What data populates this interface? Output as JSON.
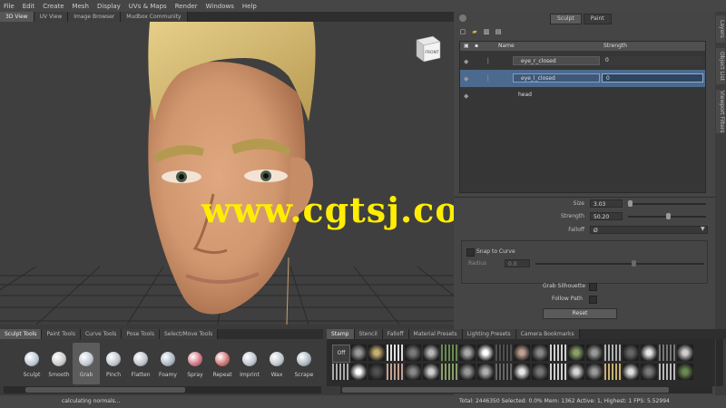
{
  "menubar": [
    "File",
    "Edit",
    "Create",
    "Mesh",
    "Display",
    "UVs & Maps",
    "Render",
    "Windows",
    "Help"
  ],
  "viewport_tabs": [
    {
      "label": "3D View",
      "active": true
    },
    {
      "label": "UV View",
      "active": false
    },
    {
      "label": "Image Browser",
      "active": false
    },
    {
      "label": "Mudbox Community",
      "active": false
    }
  ],
  "viewcube_label": "FRONT",
  "watermark": "www.cgtsj.com",
  "panel_tabs": [
    {
      "label": "Sculpt",
      "active": true
    },
    {
      "label": "Paint",
      "active": false
    }
  ],
  "side_tabs": [
    "Layers",
    "Object List",
    "Viewport Filters"
  ],
  "layers": {
    "headers": {
      "name": "Name",
      "strength": "Strength"
    },
    "rows": [
      {
        "name": "eye_r_closed",
        "strength": "0",
        "selected": false
      },
      {
        "name": "eye_l_closed",
        "strength": "0",
        "selected": true
      },
      {
        "name": "head",
        "strength": "",
        "selected": false
      }
    ]
  },
  "props": {
    "size_label": "Size",
    "size_value": "3.03",
    "strength_label": "Strength",
    "strength_value": "50.20",
    "falloff_label": "Falloff",
    "falloff_value": "Ø",
    "snap_label": "Snap to Curve",
    "radius_label": "Radius",
    "radius_value": "0.0",
    "grab_silhouette_label": "Grab Silhouette",
    "follow_path_label": "Follow Path",
    "reset_label": "Reset"
  },
  "bottom_tabs": [
    {
      "label": "Sculpt Tools",
      "active": true
    },
    {
      "label": "Paint Tools",
      "active": false
    },
    {
      "label": "Curve Tools",
      "active": false
    },
    {
      "label": "Pose Tools",
      "active": false
    },
    {
      "label": "Select/Move Tools",
      "active": false
    }
  ],
  "tools": [
    {
      "label": "Sculpt",
      "color": "#b9c6d4"
    },
    {
      "label": "Smooth",
      "color": "#c9c9c9"
    },
    {
      "label": "Grab",
      "color": "#bfc7cf",
      "active": true
    },
    {
      "label": "Pinch",
      "color": "#bcc3cc"
    },
    {
      "label": "Flatten",
      "color": "#bcc3cc"
    },
    {
      "label": "Foamy",
      "color": "#a9b4c0"
    },
    {
      "label": "Spray",
      "color": "#d07080"
    },
    {
      "label": "Repeat",
      "color": "#cf6d6d"
    },
    {
      "label": "Imprint",
      "color": "#bcc3cc"
    },
    {
      "label": "Wax",
      "color": "#bcc3cc"
    },
    {
      "label": "Scrape",
      "color": "#a9b4c0"
    }
  ],
  "stamp_tabs": [
    {
      "label": "Stamp",
      "active": true
    },
    {
      "label": "Stencil",
      "active": false
    },
    {
      "label": "Falloff",
      "active": false
    },
    {
      "label": "Material Presets",
      "active": false
    },
    {
      "label": "Lighting Presets",
      "active": false
    },
    {
      "label": "Camera Bookmarks",
      "active": false
    }
  ],
  "stamp_off_label": "Off",
  "status": {
    "left": "calculating normals...",
    "right": "Total: 2446350  Selected: 0.0%  Mem: 1362  Active: 1, Highest: 1  FPS: 5.52994"
  }
}
